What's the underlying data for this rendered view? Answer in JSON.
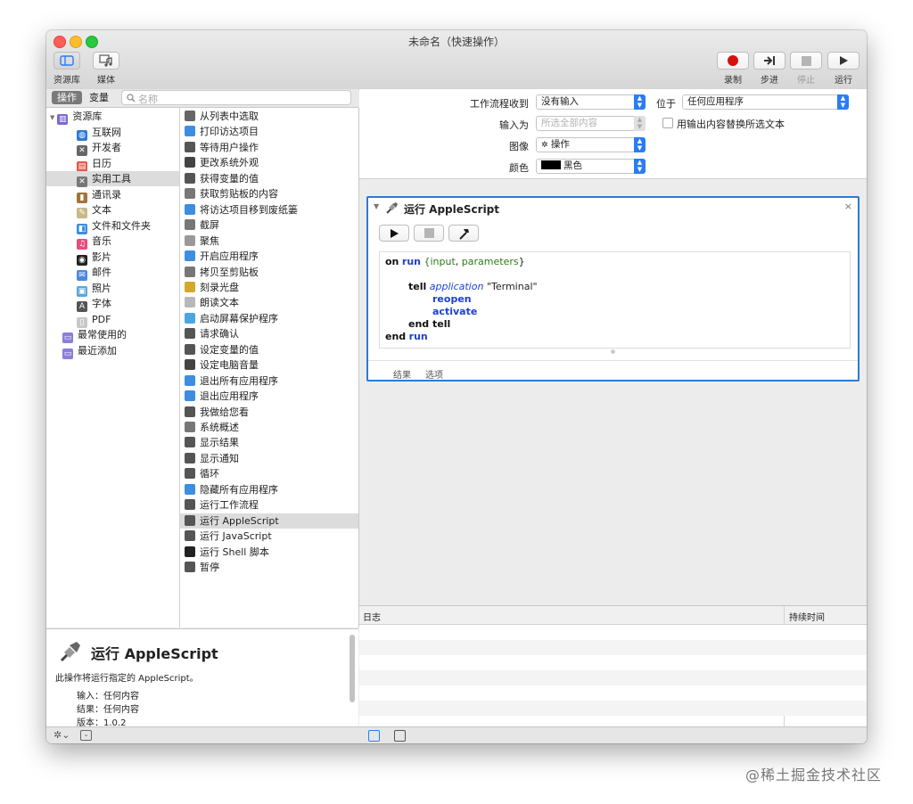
{
  "window": {
    "title": "未命名（快速操作）"
  },
  "toolbar": {
    "library_label": "资源库",
    "media_label": "媒体",
    "record_label": "录制",
    "step_label": "步进",
    "stop_label": "停止",
    "run_label": "运行"
  },
  "left_header": {
    "tab_actions": "操作",
    "tab_variables": "变量",
    "search_placeholder": "名称"
  },
  "library": [
    {
      "label": "资源库",
      "icon": "library-icon"
    },
    {
      "label": "互联网",
      "icon": "globe-icon"
    },
    {
      "label": "开发者",
      "icon": "tools-icon"
    },
    {
      "label": "日历",
      "icon": "calendar-icon"
    },
    {
      "label": "实用工具",
      "icon": "utilities-icon"
    },
    {
      "label": "通讯录",
      "icon": "contacts-icon"
    },
    {
      "label": "文本",
      "icon": "text-icon"
    },
    {
      "label": "文件和文件夹",
      "icon": "finder-icon"
    },
    {
      "label": "音乐",
      "icon": "music-icon"
    },
    {
      "label": "影片",
      "icon": "movie-icon"
    },
    {
      "label": "邮件",
      "icon": "mail-icon"
    },
    {
      "label": "照片",
      "icon": "photos-icon"
    },
    {
      "label": "字体",
      "icon": "font-icon"
    },
    {
      "label": "PDF",
      "icon": "pdf-icon"
    },
    {
      "label": "最常使用的",
      "icon": "folder-icon"
    },
    {
      "label": "最近添加",
      "icon": "folder-icon"
    }
  ],
  "actions": [
    "从列表中选取",
    "打印访达项目",
    "等待用户操作",
    "更改系统外观",
    "获得变量的值",
    "获取剪贴板的内容",
    "将访达项目移到废纸篓",
    "截屏",
    "聚焦",
    "开启应用程序",
    "拷贝至剪贴板",
    "刻录光盘",
    "朗读文本",
    "启动屏幕保护程序",
    "请求确认",
    "设定变量的值",
    "设定电脑音量",
    "退出所有应用程序",
    "退出应用程序",
    "我做给您看",
    "系统概述",
    "显示结果",
    "显示通知",
    "循环",
    "隐藏所有应用程序",
    "运行工作流程",
    "运行 AppleScript",
    "运行 JavaScript",
    "运行 Shell 脚本",
    "暂停"
  ],
  "description": {
    "title": "运行 AppleScript",
    "text": "此操作将运行指定的 AppleScript。",
    "input_label": "输入：",
    "input_value": "任何内容",
    "result_label": "结果：",
    "result_value": "任何内容",
    "version_label": "版本：",
    "version_value": "1.0.2"
  },
  "settings": {
    "workflow_receives_label": "工作流程收到",
    "workflow_receives_value": "没有输入",
    "in_label": "位于",
    "in_value": "任何应用程序",
    "input_is_label": "输入为",
    "input_is_value": "所选全部内容",
    "replace_label": "用输出内容替换所选文本",
    "image_label": "图像",
    "image_value": "操作",
    "color_label": "颜色",
    "color_value": "黑色"
  },
  "action_panel": {
    "title": "运行 AppleScript",
    "tab_results": "结果",
    "tab_options": "选项"
  },
  "code": {
    "l1_kw1": "on",
    "l1_kw2": "run",
    "l1_b1": "{",
    "l1_v1": "input",
    "l1_c": ", ",
    "l1_v2": "parameters",
    "l1_b2": "}",
    "l3_kw": "tell",
    "l3_app": "application",
    "l3_str": "\"Terminal\"",
    "l4": "reopen",
    "l5": "activate",
    "l6": "end tell",
    "l7_kw": "end",
    "l7_run": "run"
  },
  "log": {
    "col_log": "日志",
    "col_duration": "持续时间"
  },
  "watermark": "@稀土掘金技术社区",
  "colors": {
    "accent": "#2a7cf6",
    "selection": "#dcdcdc",
    "record": "#d80f0f"
  }
}
